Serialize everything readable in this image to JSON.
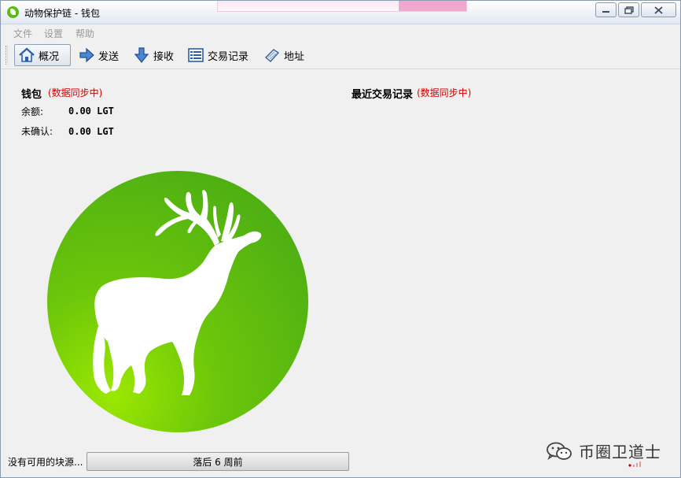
{
  "window": {
    "title": "动物保护链 - 钱包"
  },
  "menu": {
    "items": [
      "文件",
      "设置",
      "帮助"
    ]
  },
  "toolbar": {
    "buttons": [
      {
        "label": "概况",
        "icon": "home-icon"
      },
      {
        "label": "发送",
        "icon": "send-arrow-icon"
      },
      {
        "label": "接收",
        "icon": "receive-arrow-icon"
      },
      {
        "label": "交易记录",
        "icon": "transactions-list-icon"
      },
      {
        "label": "地址",
        "icon": "address-book-icon"
      }
    ],
    "active_index": 0
  },
  "wallet": {
    "title": "钱包",
    "sync_status": "(数据同步中)",
    "balance_label": "余额:",
    "balance_value": "0.00 LGT",
    "unconfirmed_label": "未确认:",
    "unconfirmed_value": "0.00 LGT"
  },
  "recent": {
    "title": "最近交易记录",
    "sync_status": "(数据同步中)"
  },
  "status": {
    "text": "没有可用的块源...",
    "progress_text": "落后 6 周前"
  },
  "watermark": {
    "text": "币圈卫道士"
  },
  "colors": {
    "logo_green": "#5bbb11",
    "sync_red": "#d00000"
  }
}
